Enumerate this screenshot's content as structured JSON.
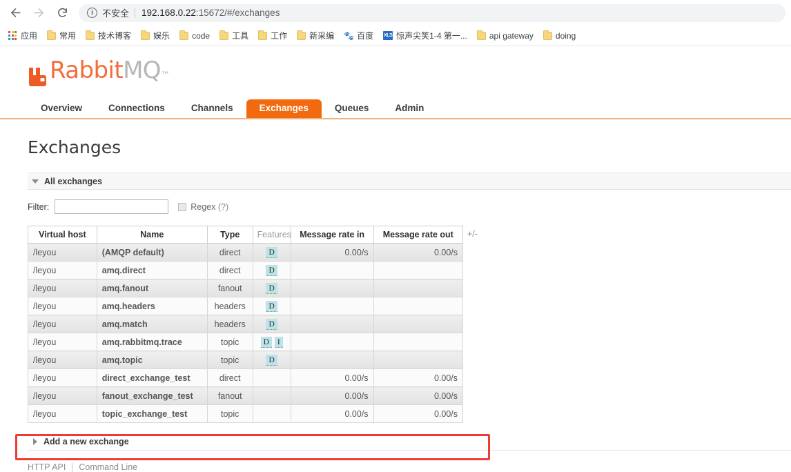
{
  "browser": {
    "back_icon": "back-arrow-icon",
    "forward_icon": "forward-arrow-icon",
    "reload_icon": "reload-icon",
    "security_icon": "info-circle-icon",
    "security_label": "不安全",
    "url_host": "192.168.0.22",
    "url_rest": ":15672/#/exchanges",
    "bookmarks": [
      {
        "icon": "apps-grid-icon",
        "label": "应用"
      },
      {
        "icon": "folder-icon",
        "label": "常用"
      },
      {
        "icon": "folder-icon",
        "label": "技术博客"
      },
      {
        "icon": "folder-icon",
        "label": "娱乐"
      },
      {
        "icon": "folder-icon",
        "label": "code"
      },
      {
        "icon": "folder-icon",
        "label": "工具"
      },
      {
        "icon": "folder-icon",
        "label": "工作"
      },
      {
        "icon": "folder-icon",
        "label": "新采编"
      },
      {
        "icon": "baidu-icon",
        "label": "百度"
      },
      {
        "icon": "xls-icon",
        "label": "惊声尖笑1-4 第一..."
      },
      {
        "icon": "folder-icon",
        "label": "api gateway"
      },
      {
        "icon": "folder-icon",
        "label": "doing"
      }
    ]
  },
  "app": {
    "logo_rabbit": "Rabbit",
    "logo_mq": "MQ",
    "logo_tm": "™",
    "tabs": [
      {
        "label": "Overview",
        "active": false
      },
      {
        "label": "Connections",
        "active": false
      },
      {
        "label": "Channels",
        "active": false
      },
      {
        "label": "Exchanges",
        "active": true
      },
      {
        "label": "Queues",
        "active": false
      },
      {
        "label": "Admin",
        "active": false
      }
    ],
    "page_title": "Exchanges"
  },
  "section": {
    "all_exchanges_label": "All exchanges",
    "add_exchange_label": "Add a new exchange"
  },
  "filter": {
    "label": "Filter:",
    "value": "",
    "placeholder": "",
    "regex_label": "Regex",
    "regex_help": "(?)",
    "regex_checked": false
  },
  "table": {
    "columns": [
      "Virtual host",
      "Name",
      "Type",
      "Features",
      "Message rate in",
      "Message rate out"
    ],
    "plus_minus": "+/-",
    "rows": [
      {
        "vhost": "/leyou",
        "name": "(AMQP default)",
        "type": "direct",
        "features": [
          "D"
        ],
        "rate_in": "0.00/s",
        "rate_out": "0.00/s",
        "highlighted": false
      },
      {
        "vhost": "/leyou",
        "name": "amq.direct",
        "type": "direct",
        "features": [
          "D"
        ],
        "rate_in": "",
        "rate_out": "",
        "highlighted": false
      },
      {
        "vhost": "/leyou",
        "name": "amq.fanout",
        "type": "fanout",
        "features": [
          "D"
        ],
        "rate_in": "",
        "rate_out": "",
        "highlighted": false
      },
      {
        "vhost": "/leyou",
        "name": "amq.headers",
        "type": "headers",
        "features": [
          "D"
        ],
        "rate_in": "",
        "rate_out": "",
        "highlighted": false
      },
      {
        "vhost": "/leyou",
        "name": "amq.match",
        "type": "headers",
        "features": [
          "D"
        ],
        "rate_in": "",
        "rate_out": "",
        "highlighted": false
      },
      {
        "vhost": "/leyou",
        "name": "amq.rabbitmq.trace",
        "type": "topic",
        "features": [
          "D",
          "I"
        ],
        "rate_in": "",
        "rate_out": "",
        "highlighted": false
      },
      {
        "vhost": "/leyou",
        "name": "amq.topic",
        "type": "topic",
        "features": [
          "D"
        ],
        "rate_in": "",
        "rate_out": "",
        "highlighted": false
      },
      {
        "vhost": "/leyou",
        "name": "direct_exchange_test",
        "type": "direct",
        "features": [],
        "rate_in": "0.00/s",
        "rate_out": "0.00/s",
        "highlighted": false
      },
      {
        "vhost": "/leyou",
        "name": "fanout_exchange_test",
        "type": "fanout",
        "features": [],
        "rate_in": "0.00/s",
        "rate_out": "0.00/s",
        "highlighted": false
      },
      {
        "vhost": "/leyou",
        "name": "topic_exchange_test",
        "type": "topic",
        "features": [],
        "rate_in": "0.00/s",
        "rate_out": "0.00/s",
        "highlighted": true
      }
    ]
  },
  "footer": {
    "http_api": "HTTP API",
    "command_line": "Command Line"
  },
  "colors": {
    "accent_orange": "#f26a0f",
    "logo_orange": "#f26d3d",
    "tab_underline": "#f2b27f",
    "feature_badge": "#bde3e8",
    "highlight_red": "#ef3b36"
  }
}
